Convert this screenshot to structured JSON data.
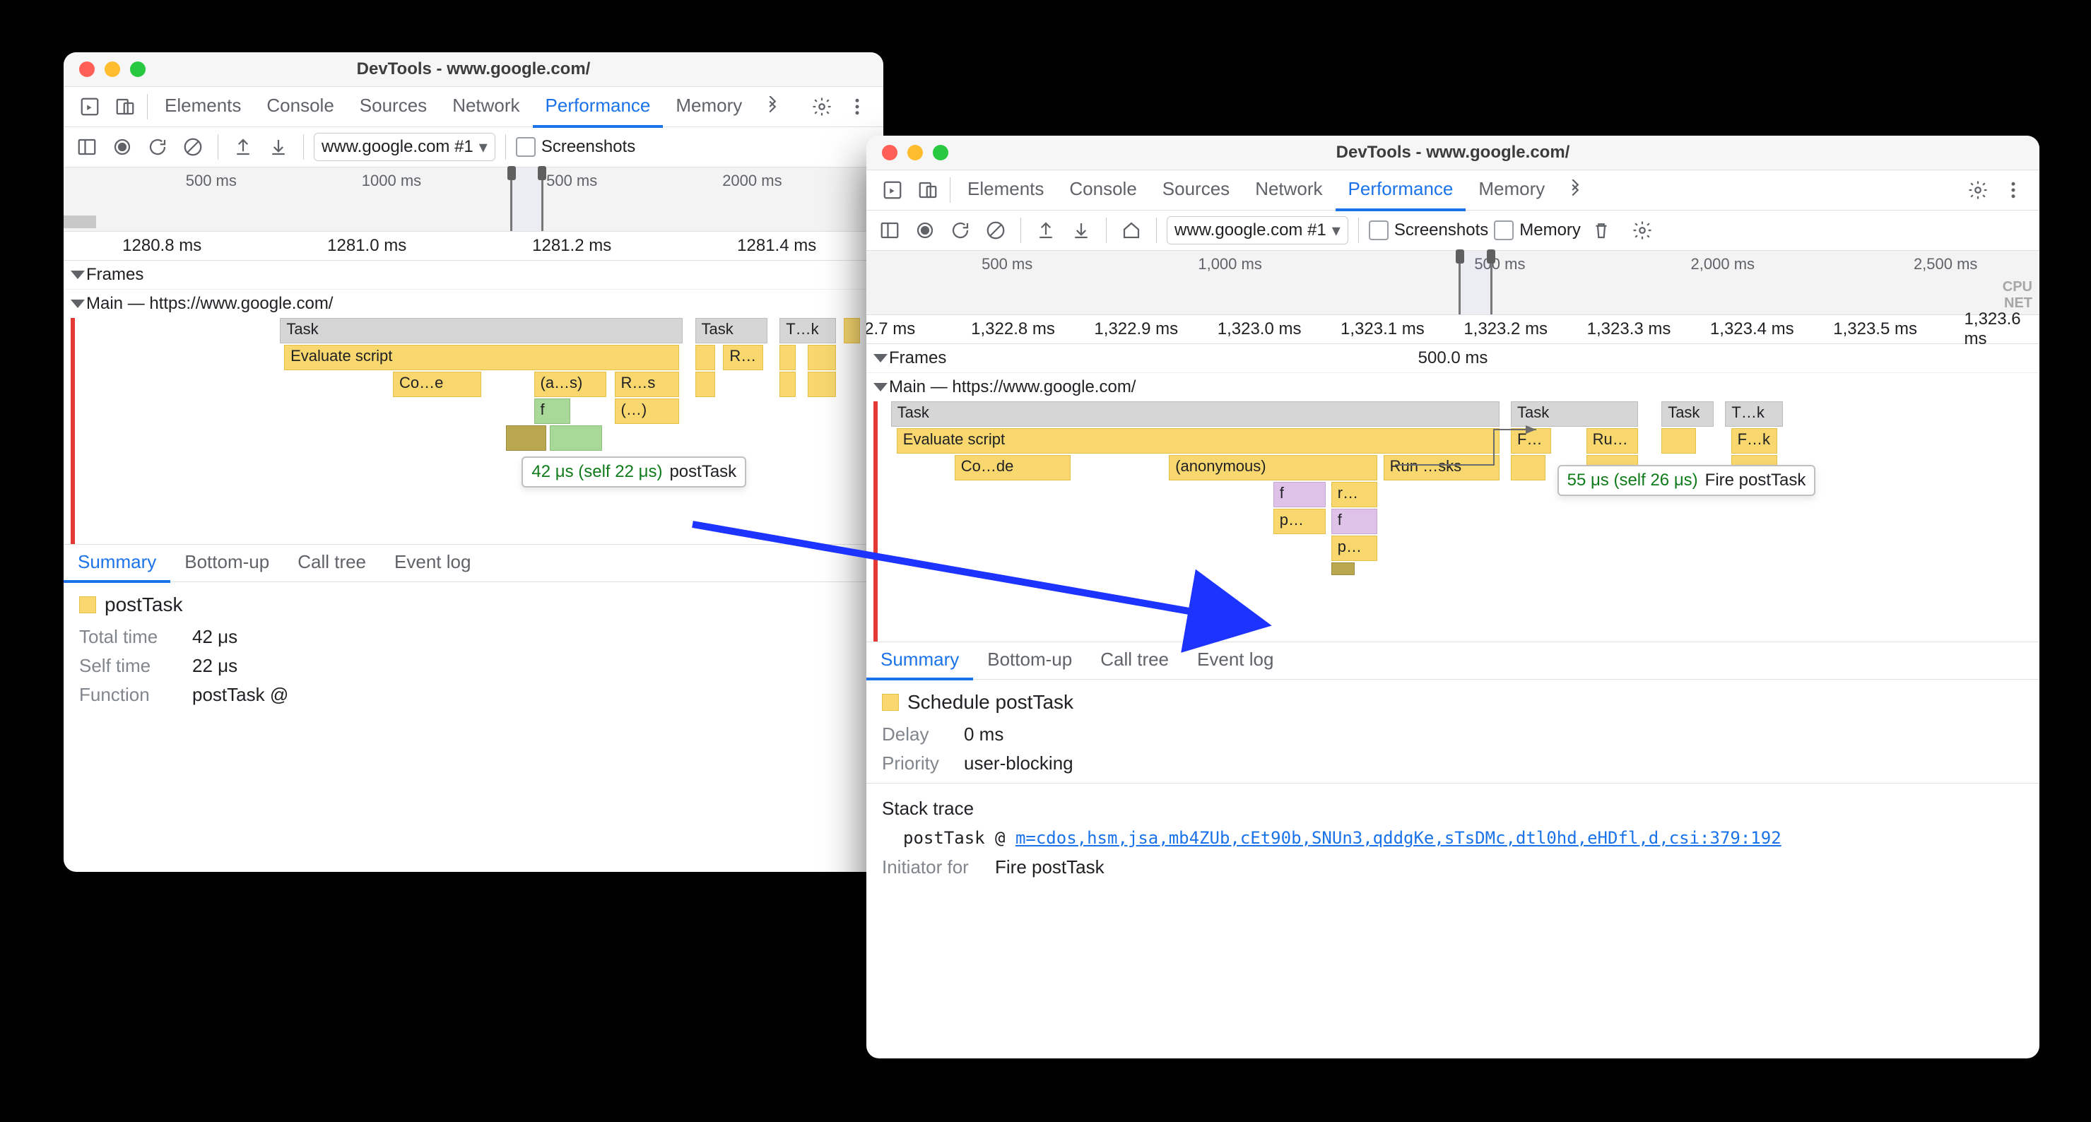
{
  "left": {
    "title": "DevTools - www.google.com/",
    "tabs": {
      "elements": "Elements",
      "console": "Console",
      "sources": "Sources",
      "network": "Network",
      "performance": "Performance",
      "memory": "Memory"
    },
    "toolbar": {
      "url": "www.google.com #1",
      "screenshots": "Screenshots"
    },
    "overview_ticks": [
      "500 ms",
      "1000 ms",
      "500 ms",
      "2000 ms"
    ],
    "ruler_ticks": [
      "1280.8 ms",
      "1281.0 ms",
      "1281.2 ms",
      "1281.4 ms"
    ],
    "frames_label": "Frames",
    "main_label": "Main — https://www.google.com/",
    "flame": {
      "task1": "Task",
      "eval": "Evaluate script",
      "coe": "Co…e",
      "as": "(a…s)",
      "rs": "R…s",
      "f": "f",
      "paren": "(…)",
      "task2": "Task",
      "r": "R…",
      "tk": "T…k"
    },
    "tooltip": {
      "time": "42 μs (self 22 μs)",
      "name": "postTask"
    },
    "detail_tabs": {
      "summary": "Summary",
      "bottomup": "Bottom-up",
      "calltree": "Call tree",
      "eventlog": "Event log"
    },
    "detail": {
      "title": "postTask",
      "total_k": "Total time",
      "total_v": "42 μs",
      "self_k": "Self time",
      "self_v": "22 μs",
      "func_k": "Function",
      "func_v": "postTask @"
    }
  },
  "right": {
    "title": "DevTools - www.google.com/",
    "tabs": {
      "elements": "Elements",
      "console": "Console",
      "sources": "Sources",
      "network": "Network",
      "performance": "Performance",
      "memory": "Memory"
    },
    "toolbar": {
      "url": "www.google.com #1",
      "screenshots": "Screenshots",
      "memory": "Memory"
    },
    "overview_ticks": [
      "500 ms",
      "1,000 ms",
      "500 ms",
      "2,000 ms",
      "2,500 ms"
    ],
    "cpu": "CPU",
    "net": "NET",
    "ruler_ticks": [
      "2.7 ms",
      "1,322.8 ms",
      "1,322.9 ms",
      "1,323.0 ms",
      "1,323.1 ms",
      "1,323.2 ms",
      "1,323.3 ms",
      "1,323.4 ms",
      "1,323.5 ms",
      "1,323.6 ms"
    ],
    "frames_label": "Frames",
    "frames_ms": "500.0 ms",
    "main_label": "Main — https://www.google.com/",
    "flame": {
      "task1": "Task",
      "task2": "Task",
      "task3": "Task",
      "tk": "T…k",
      "eval": "Evaluate script",
      "code": "Co…de",
      "anon": "(anonymous)",
      "run": "Run …sks",
      "fik": "Fi…k",
      "rus": "Ru…s",
      "fk": "F…k",
      "f": "f",
      "r": "r…",
      "p1": "p…",
      "f2": "f",
      "p2": "p…"
    },
    "tooltip": {
      "time": "55 μs (self 26 μs)",
      "name": "Fire postTask"
    },
    "detail_tabs": {
      "summary": "Summary",
      "bottomup": "Bottom-up",
      "calltree": "Call tree",
      "eventlog": "Event log"
    },
    "detail": {
      "title": "Schedule postTask",
      "delay_k": "Delay",
      "delay_v": "0 ms",
      "prio_k": "Priority",
      "prio_v": "user-blocking",
      "stack_head": "Stack trace",
      "stack_fn": "postTask @ ",
      "stack_link": "m=cdos,hsm,jsa,mb4ZUb,cEt90b,SNUn3,qddgKe,sTsDMc,dtl0hd,eHDfl,d,csi:379:192",
      "initfor_k": "Initiator for",
      "initfor_v": "Fire postTask"
    }
  }
}
